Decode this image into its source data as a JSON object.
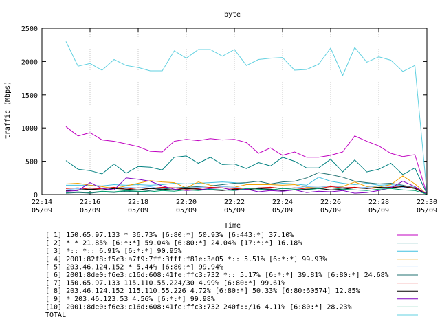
{
  "chart_data": {
    "type": "line",
    "title": "byte",
    "xlabel": "Time",
    "ylabel": "traffic (Mbps)",
    "ylim": [
      0,
      2500
    ],
    "xlim": [
      "22:14",
      "22:30"
    ],
    "yticks": [
      0,
      500,
      1000,
      1500,
      2000,
      2500
    ],
    "xticks": [
      {
        "time": "22:14",
        "date": "05/09"
      },
      {
        "time": "22:16",
        "date": "05/09"
      },
      {
        "time": "22:18",
        "date": "05/09"
      },
      {
        "time": "22:20",
        "date": "05/09"
      },
      {
        "time": "22:22",
        "date": "05/09"
      },
      {
        "time": "22:24",
        "date": "05/09"
      },
      {
        "time": "22:26",
        "date": "05/09"
      },
      {
        "time": "22:28",
        "date": "05/09"
      },
      {
        "time": "22:30",
        "date": "05/09"
      }
    ],
    "x": [
      "22:15",
      "22:15:30",
      "22:16",
      "22:16:30",
      "22:17",
      "22:17:30",
      "22:18",
      "22:18:30",
      "22:19",
      "22:19:30",
      "22:20",
      "22:20:30",
      "22:21",
      "22:21:30",
      "22:22",
      "22:22:30",
      "22:23",
      "22:23:30",
      "22:24",
      "22:24:30",
      "22:25",
      "22:25:30",
      "22:26",
      "22:26:30",
      "22:27",
      "22:27:30",
      "22:28",
      "22:28:30",
      "22:29",
      "22:29:30",
      "22:30"
    ],
    "grid": true,
    "legend_position": "bottom",
    "series": [
      {
        "name": "[ 1] 150.65.97.133 * 36.73%  [6:80:*] 50.93% [6:443:*] 37.10%",
        "color": "#c000c0",
        "values": [
          1020,
          880,
          930,
          820,
          800,
          760,
          720,
          650,
          640,
          800,
          830,
          810,
          840,
          820,
          830,
          780,
          620,
          700,
          590,
          640,
          560,
          560,
          590,
          640,
          880,
          800,
          730,
          620,
          570,
          600,
          10
        ]
      },
      {
        "name": "[ 2] * * 21.85%  [6:*:*] 59.04% [6:80:*] 24.04% [17:*:*] 16.18%",
        "color": "#008080",
        "values": [
          510,
          380,
          360,
          310,
          460,
          320,
          420,
          410,
          370,
          560,
          580,
          470,
          560,
          450,
          460,
          390,
          480,
          430,
          560,
          500,
          400,
          400,
          530,
          340,
          520,
          340,
          380,
          470,
          300,
          400,
          10
        ]
      },
      {
        "name": "[ 3] *:: *:: 6.91%  [6:*:*] 90.95%",
        "color": "#40c0e0",
        "values": [
          140,
          140,
          140,
          130,
          150,
          140,
          150,
          140,
          150,
          170,
          160,
          170,
          180,
          190,
          180,
          160,
          150,
          150,
          170,
          160,
          140,
          260,
          200,
          170,
          150,
          170,
          140,
          150,
          130,
          110,
          5
        ]
      },
      {
        "name": "[ 4] 2001:82f8:f5c3:a7f9:7ff:3fff:f81e:3e05 *:: 5.51%  [6:*:*] 99.93%",
        "color": "#f0a000",
        "values": [
          160,
          170,
          140,
          120,
          90,
          130,
          170,
          210,
          190,
          180,
          100,
          190,
          140,
          120,
          110,
          150,
          150,
          150,
          140,
          150,
          110,
          110,
          130,
          120,
          190,
          120,
          110,
          150,
          280,
          160,
          5
        ]
      },
      {
        "name": "[ 5] 203.46.124.152 * 5.44%  [6:80:*] 99.94%",
        "color": "#80c0ff",
        "values": [
          70,
          90,
          80,
          100,
          90,
          110,
          100,
          120,
          80,
          100,
          90,
          110,
          100,
          120,
          110,
          90,
          100,
          110,
          90,
          100,
          120,
          110,
          130,
          110,
          100,
          110,
          130,
          120,
          110,
          100,
          5
        ]
      },
      {
        "name": "[ 6] 2001:8de0:f6e3:c16d:608:41fe:ffc3:732 *:: 5.17%  [6:*:*] 39.81% [6:80:*] 24.68%",
        "color": "#207070",
        "values": [
          20,
          30,
          20,
          40,
          30,
          50,
          40,
          60,
          80,
          100,
          110,
          120,
          130,
          150,
          170,
          180,
          200,
          160,
          190,
          200,
          250,
          330,
          300,
          260,
          200,
          180,
          160,
          170,
          140,
          100,
          5
        ]
      },
      {
        "name": "[ 7] 150.65.97.133 115.110.55.224/30 4.99%  [6:80:*] 99.61%",
        "color": "#e00000",
        "values": [
          90,
          100,
          80,
          90,
          110,
          80,
          100,
          90,
          110,
          100,
          80,
          90,
          110,
          100,
          90,
          80,
          100,
          110,
          90,
          100,
          80,
          90,
          120,
          100,
          110,
          90,
          100,
          110,
          120,
          100,
          5
        ]
      },
      {
        "name": "[ 8] 203.46.124.152 115.110.55.226 4.72%  [6:80:*] 50.33% [6:80:60574] 12.85%",
        "color": "#000000",
        "values": [
          60,
          70,
          80,
          70,
          90,
          80,
          70,
          90,
          80,
          70,
          90,
          80,
          70,
          60,
          80,
          70,
          90,
          80,
          60,
          70,
          80,
          90,
          70,
          80,
          100,
          90,
          110,
          100,
          120,
          90,
          5
        ]
      },
      {
        "name": "[ 9] * 203.46.123.53 4.56%  [6:*:*] 99.98%",
        "color": "#8000c0",
        "values": [
          50,
          60,
          180,
          90,
          70,
          250,
          230,
          200,
          130,
          80,
          60,
          70,
          90,
          100,
          60,
          80,
          40,
          60,
          50,
          70,
          30,
          50,
          40,
          60,
          20,
          30,
          60,
          100,
          200,
          120,
          5
        ]
      },
      {
        "name": "[10] 2001:8de0:f6e3:c16d:608:41fe:ffc3:732 240f::/16 4.11%  [6:80:*] 28.23%",
        "color": "#00a070",
        "values": [
          30,
          40,
          30,
          50,
          40,
          60,
          50,
          40,
          60,
          50,
          70,
          60,
          80,
          70,
          60,
          90,
          80,
          70,
          90,
          80,
          70,
          90,
          100,
          80,
          70,
          60,
          80,
          90,
          70,
          60,
          5
        ]
      },
      {
        "name": "TOTAL",
        "color": "#60d0e0",
        "values": [
          2300,
          1930,
          1970,
          1870,
          2030,
          1940,
          1910,
          1860,
          1860,
          2160,
          2050,
          2180,
          2180,
          2080,
          2180,
          1940,
          2030,
          2050,
          2060,
          1870,
          1880,
          1960,
          2200,
          1790,
          2210,
          1990,
          2070,
          2020,
          1850,
          1940,
          20
        ]
      }
    ]
  }
}
